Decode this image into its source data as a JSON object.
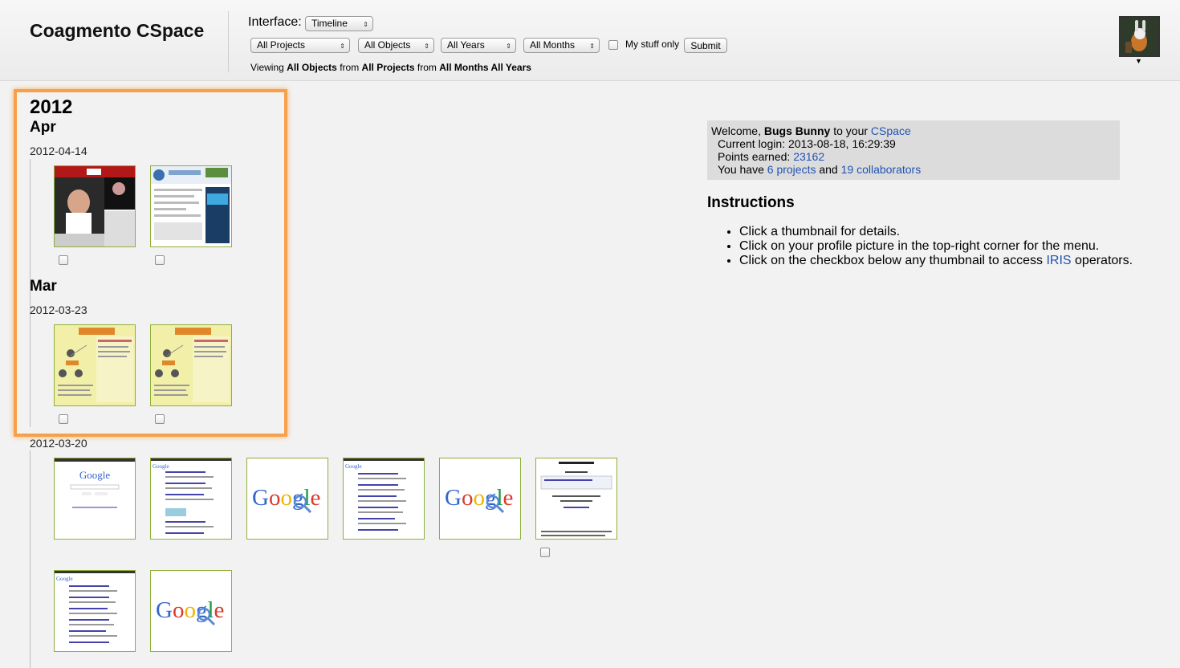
{
  "app": {
    "title": "Coagmento CSpace"
  },
  "toolbar": {
    "interface_label": "Interface:",
    "interface_value": "Timeline",
    "projects_value": "All Projects",
    "objects_value": "All Objects",
    "years_value": "All Years",
    "months_value": "All Months",
    "mystuff_label": "My stuff only",
    "submit_label": "Submit"
  },
  "viewing": {
    "prefix": "Viewing",
    "objects": "All Objects",
    "from1": "from",
    "projects": "All Projects",
    "from2": "from",
    "months_years": "All Months All Years"
  },
  "timeline": {
    "year": "2012",
    "months": [
      {
        "label": "Apr",
        "dates": [
          {
            "label": "2012-04-14"
          }
        ]
      },
      {
        "label": "Mar",
        "dates": [
          {
            "label": "2012-03-23"
          },
          {
            "label": "2012-03-20"
          }
        ]
      }
    ]
  },
  "welcome": {
    "greeting": "Welcome,",
    "user": "Bugs Bunny",
    "to_your": "to your",
    "cspace_link": "CSpace",
    "login_label": "Current login:",
    "login_value": "2013-08-18, 16:29:39",
    "points_label": "Points earned:",
    "points_value": "23162",
    "you_have": "You have",
    "projects_link": "6 projects",
    "and": "and",
    "collab_link": "19 collaborators"
  },
  "instructions": {
    "title": "Instructions",
    "item1": "Click a thumbnail for details.",
    "item2": "Click on your profile picture in the top-right corner for the menu.",
    "item3_prefix": "Click on the checkbox below any thumbnail to access",
    "item3_link": "IRIS",
    "item3_suffix": "operators."
  },
  "icons": {
    "select_arrows": "⇕",
    "caret": "▼",
    "bullet": "•"
  },
  "colors": {
    "link": "#2053b3",
    "highlight": "#f6a14a",
    "thumb_border": "#8fae3a"
  }
}
